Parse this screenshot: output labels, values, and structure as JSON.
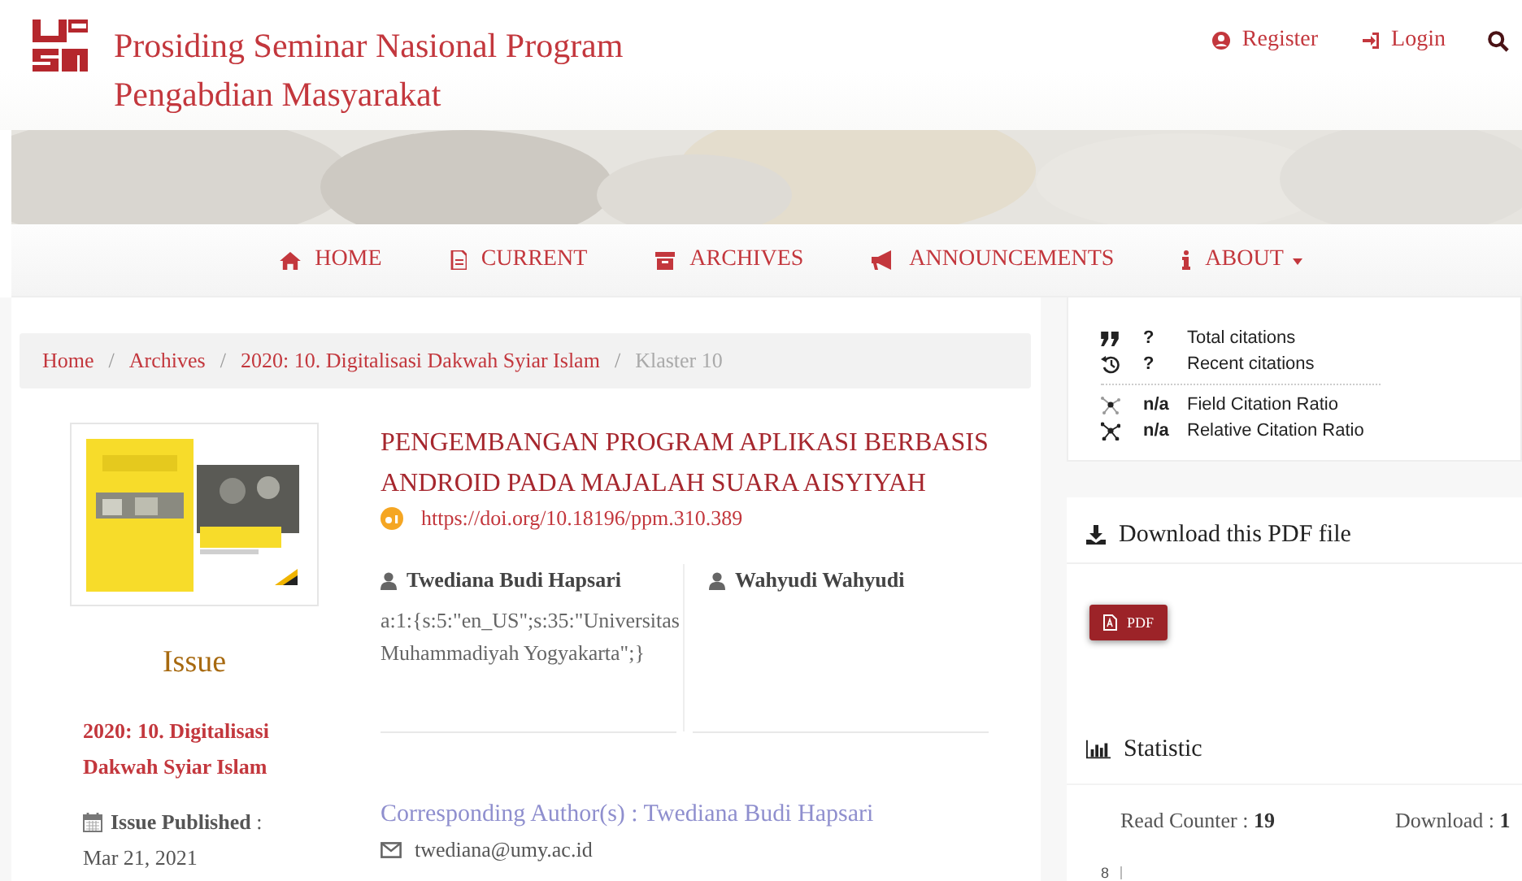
{
  "site": {
    "title_lines": [
      "Prosiding Seminar Nasional Program",
      "Pengabdian Masyarakat"
    ],
    "user_links": [
      {
        "kind": "register",
        "label": "Register"
      },
      {
        "kind": "login",
        "label": "Login"
      }
    ]
  },
  "nav": [
    {
      "kind": "home",
      "label": "HOME",
      "dropdown": false
    },
    {
      "kind": "current",
      "label": "CURRENT",
      "dropdown": false
    },
    {
      "kind": "archives",
      "label": "ARCHIVES",
      "dropdown": false
    },
    {
      "kind": "announcements",
      "label": "ANNOUNCEMENTS",
      "dropdown": false
    },
    {
      "kind": "about",
      "label": "ABOUT",
      "dropdown": true
    }
  ],
  "breadcrumb": [
    {
      "label": "Home",
      "current": false
    },
    {
      "separator": "/",
      "label": "Archives",
      "current": false
    },
    {
      "separator": "/",
      "label": "2020: 10. Digitalisasi Dakwah Syiar Islam",
      "current": false
    },
    {
      "separator": "/",
      "label": "Klaster 10",
      "current": true
    }
  ],
  "issue": {
    "heading": "Issue",
    "title": "2020: 10. Digitalisasi Dakwah Syiar Islam",
    "published": "**Issue Published** :",
    "date": "Mar 21, 2021"
  },
  "article": {
    "title": "PENGEMBANGAN PROGRAM APLIKASI BERBASIS ANDROID PADA MAJALAH SUARA AISYIYAH",
    "doi": "https://doi.org/10.18196/ppm.310.389",
    "authors": [
      {
        "name": "Twediana Budi Hapsari",
        "affiliation": "a:1:{s:5:\"en_US\";s:35:\"Universitas Muhammadiyah Yogyakarta\";}"
      },
      {
        "name": "Wahyudi Wahyudi"
      }
    ],
    "corresponding": "Corresponding Author(s) : Twediana Budi Hapsari",
    "email": "twediana@umy.ac.id"
  },
  "citations": [
    {
      "kind": "total",
      "value": "?",
      "label": "Total citations"
    },
    {
      "kind": "recent",
      "value": "?",
      "label": "Recent citations"
    },
    {
      "kind": "field",
      "value": "n/a",
      "label": "Field Citation Ratio"
    },
    {
      "kind": "relative",
      "value": "n/a",
      "label": "Relative Citation Ratio"
    }
  ],
  "download": {
    "heading": "Download this PDF file",
    "button": "PDF"
  },
  "statistic": {
    "heading": "Statistic",
    "read_label": "Read Counter :",
    "read_value": "19",
    "download_label": "Download :",
    "download_value": "1",
    "axis_tick": "8"
  }
}
